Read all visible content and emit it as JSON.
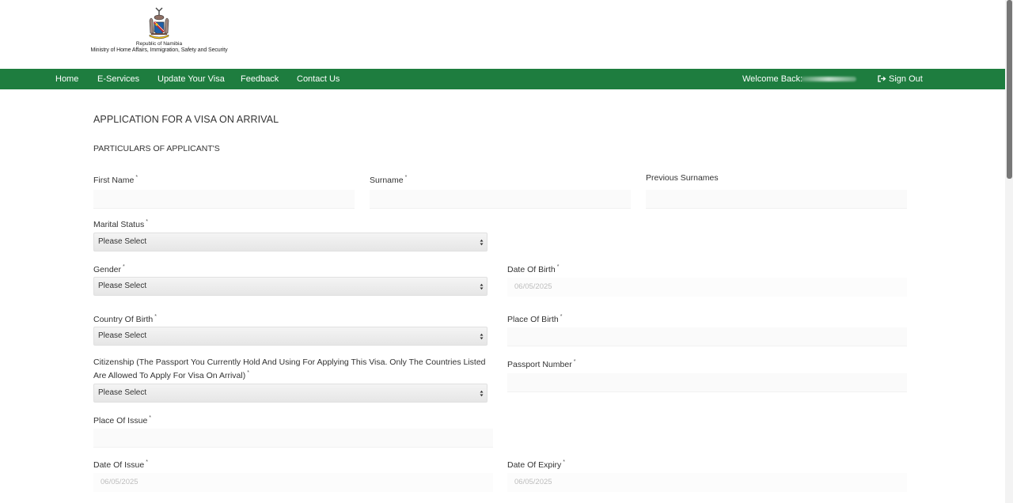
{
  "header": {
    "org_line1": "Republic of Namibia",
    "org_line2": "Ministry of Home Affairs, Immigration, Safety and Security"
  },
  "nav": {
    "items": [
      "Home",
      "E-Services",
      "Update Your Visa",
      "Feedback",
      "Contact Us"
    ],
    "welcome": "Welcome Back:",
    "signout": "Sign Out",
    "signout_icon": "sign-out-icon",
    "bar_color": "#1e7d3f"
  },
  "form": {
    "title": "APPLICATION FOR A VISA ON ARRIVAL",
    "subtitle": "PARTICULARS OF APPLICANT'S",
    "required_marker": "*",
    "first_name": "First Name",
    "surname": "Surname",
    "previous_surnames": "Previous Surnames",
    "marital_status": "Marital Status",
    "gender": "Gender",
    "date_of_birth": "Date Of Birth",
    "country_of_birth": "Country Of Birth",
    "place_of_birth": "Place Of Birth",
    "citizenship": "Citizenship (The Passport You Currently Hold And Using For Applying This Visa. Only The Countries Listed Are Allowed To Apply For Visa On Arrival)",
    "passport_number": "Passport Number",
    "place_of_issue": "Place Of Issue",
    "date_of_issue": "Date Of Issue",
    "date_of_expiry": "Date Of Expiry",
    "select_placeholder": "Please Select",
    "date_placeholder": "06/05/2025"
  }
}
